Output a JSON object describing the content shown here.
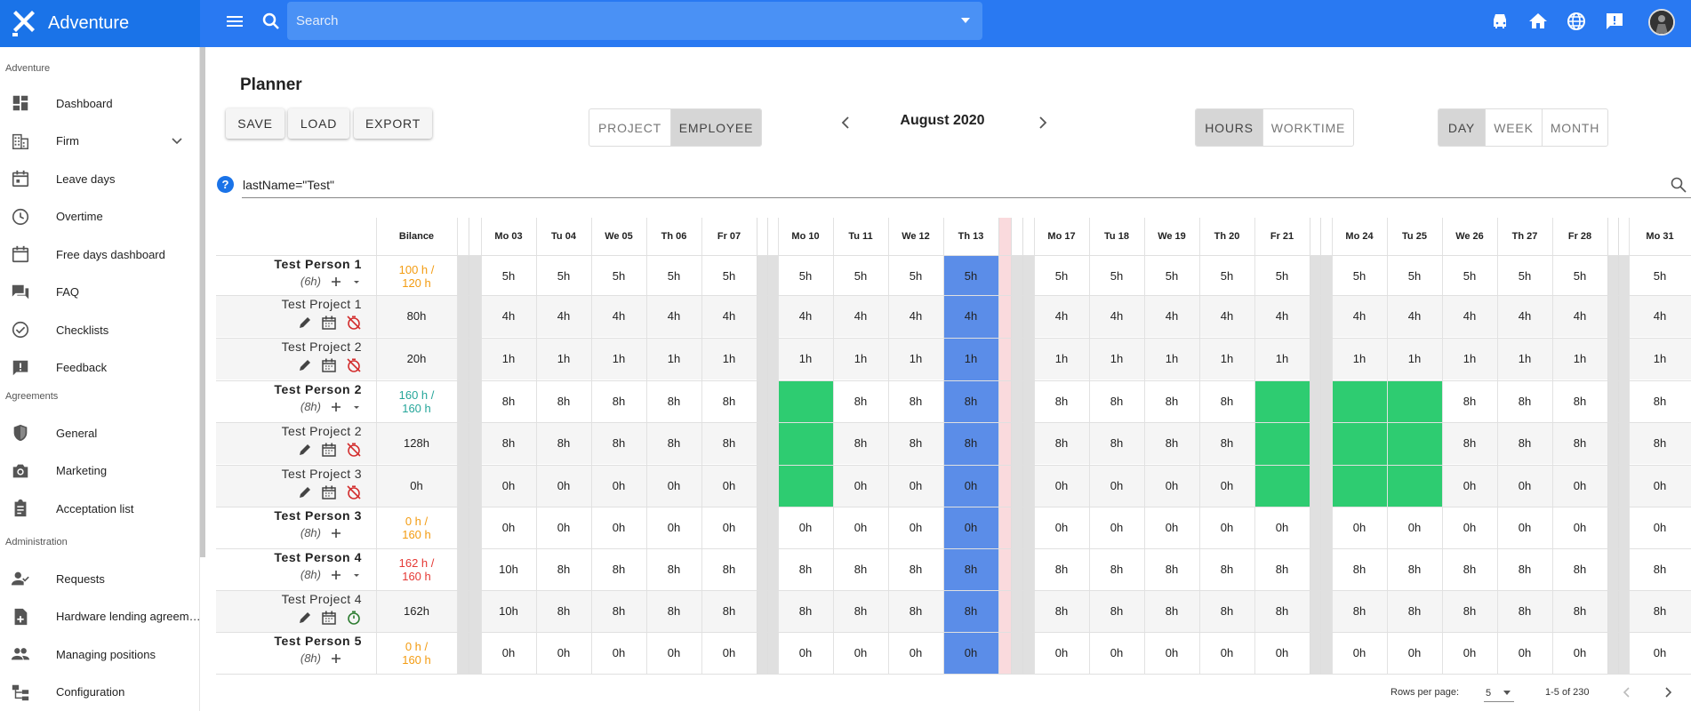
{
  "app": {
    "name": "Adventure"
  },
  "topbar": {
    "search_placeholder": "Search",
    "icons": [
      "menu-icon",
      "search-icon",
      "taxi-icon",
      "home-icon",
      "globe-icon",
      "feedback-icon",
      "avatar"
    ]
  },
  "sidebar": {
    "sections": [
      {
        "label": "Adventure",
        "items": [
          {
            "label": "Dashboard",
            "icon": "dashboard-icon"
          },
          {
            "label": "Firm",
            "icon": "firm-icon",
            "expandable": true
          },
          {
            "label": "Leave days",
            "icon": "calendar-icon"
          },
          {
            "label": "Overtime",
            "icon": "clock-icon"
          },
          {
            "label": "Free days dashboard",
            "icon": "calendar-blank-icon"
          },
          {
            "label": "FAQ",
            "icon": "forum-icon"
          },
          {
            "label": "Checklists",
            "icon": "check-circle-icon"
          },
          {
            "label": "Feedback",
            "icon": "feedback-icon"
          }
        ]
      },
      {
        "label": "Agreements",
        "items": [
          {
            "label": "General",
            "icon": "shield-icon"
          },
          {
            "label": "Marketing",
            "icon": "camera-icon"
          },
          {
            "label": "Acceptation list",
            "icon": "clipboard-icon"
          }
        ]
      },
      {
        "label": "Administration",
        "items": [
          {
            "label": "Requests",
            "icon": "person-check-icon"
          },
          {
            "label": "Hardware lending agreem…",
            "icon": "note-add-icon"
          },
          {
            "label": "Managing positions",
            "icon": "people-icon"
          },
          {
            "label": "Configuration",
            "icon": "tree-icon"
          }
        ]
      }
    ]
  },
  "planner": {
    "title": "Planner",
    "buttons": {
      "save": "SAVE",
      "load": "LOAD",
      "export": "EXPORT"
    },
    "mode_toggle": {
      "options": [
        "PROJECT",
        "EMPLOYEE"
      ],
      "active": "EMPLOYEE"
    },
    "month": "August 2020",
    "unit_toggle": {
      "options": [
        "HOURS",
        "WORKTIME"
      ],
      "active": "HOURS"
    },
    "range_toggle": {
      "options": [
        "DAY",
        "WEEK",
        "MONTH"
      ],
      "active": "DAY"
    },
    "filter": "lastName=\"Test\"",
    "bilance_header": "Bilance",
    "days": [
      "Mo 03",
      "Tu 04",
      "We 05",
      "Th 06",
      "Fr 07",
      "Mo 10",
      "Tu 11",
      "We 12",
      "Th 13",
      "Mo 17",
      "Tu 18",
      "We 19",
      "Th 20",
      "Fr 21",
      "Mo 24",
      "Tu 25",
      "We 26",
      "Th 27",
      "Fr 28",
      "Mo 31"
    ],
    "highlight_day": "Th 13",
    "rows": [
      {
        "type": "person",
        "name": "Test Person 1",
        "sub": "(6h)",
        "bilance": "100 h /",
        "bilance2": "120 h",
        "bilance_color": "#f39c12",
        "expandable": true,
        "cells": [
          "5h",
          "5h",
          "5h",
          "5h",
          "5h",
          "5h",
          "5h",
          "5h",
          "5h",
          "5h",
          "5h",
          "5h",
          "5h",
          "5h",
          "5h",
          "5h",
          "5h",
          "5h",
          "5h",
          "5h"
        ]
      },
      {
        "type": "project",
        "name": "Test Project 1",
        "bilance": "80h",
        "timer": "#d32f2f",
        "cells": [
          "4h",
          "4h",
          "4h",
          "4h",
          "4h",
          "4h",
          "4h",
          "4h",
          "4h",
          "4h",
          "4h",
          "4h",
          "4h",
          "4h",
          "4h",
          "4h",
          "4h",
          "4h",
          "4h",
          "4h"
        ]
      },
      {
        "type": "project",
        "name": "Test Project 2",
        "bilance": "20h",
        "timer": "#d32f2f",
        "cells": [
          "1h",
          "1h",
          "1h",
          "1h",
          "1h",
          "1h",
          "1h",
          "1h",
          "1h",
          "1h",
          "1h",
          "1h",
          "1h",
          "1h",
          "1h",
          "1h",
          "1h",
          "1h",
          "1h",
          "1h"
        ]
      },
      {
        "type": "person",
        "name": "Test Person 2",
        "sub": "(8h)",
        "bilance": "160 h /",
        "bilance2": "160 h",
        "bilance_color": "#26a69a",
        "expandable": true,
        "cells": [
          "8h",
          "8h",
          "8h",
          "8h",
          "8h",
          "",
          "8h",
          "8h",
          "8h",
          "8h",
          "8h",
          "8h",
          "8h",
          "",
          "",
          "",
          "8h",
          "8h",
          "8h",
          "8h"
        ]
      },
      {
        "type": "project",
        "name": "Test Project 2",
        "bilance": "128h",
        "timer": "#d32f2f",
        "cells": [
          "8h",
          "8h",
          "8h",
          "8h",
          "8h",
          "",
          "8h",
          "8h",
          "8h",
          "8h",
          "8h",
          "8h",
          "8h",
          "",
          "",
          "",
          "8h",
          "8h",
          "8h",
          "8h"
        ]
      },
      {
        "type": "project",
        "name": "Test Project 3",
        "bilance": "0h",
        "timer": "#d32f2f",
        "cells": [
          "0h",
          "0h",
          "0h",
          "0h",
          "0h",
          "",
          "0h",
          "0h",
          "0h",
          "0h",
          "0h",
          "0h",
          "0h",
          "",
          "",
          "",
          "0h",
          "0h",
          "0h",
          "0h"
        ]
      },
      {
        "type": "person",
        "name": "Test Person 3",
        "sub": "(8h)",
        "bilance": "0 h /",
        "bilance2": "160 h",
        "bilance_color": "#f39c12",
        "expandable": false,
        "cells": [
          "0h",
          "0h",
          "0h",
          "0h",
          "0h",
          "0h",
          "0h",
          "0h",
          "0h",
          "0h",
          "0h",
          "0h",
          "0h",
          "0h",
          "0h",
          "0h",
          "0h",
          "0h",
          "0h",
          "0h"
        ]
      },
      {
        "type": "person",
        "name": "Test Person 4",
        "sub": "(8h)",
        "bilance": "162 h /",
        "bilance2": "160 h",
        "bilance_color": "#e53935",
        "expandable": true,
        "cells": [
          "10h",
          "8h",
          "8h",
          "8h",
          "8h",
          "8h",
          "8h",
          "8h",
          "8h",
          "8h",
          "8h",
          "8h",
          "8h",
          "8h",
          "8h",
          "8h",
          "8h",
          "8h",
          "8h",
          "8h"
        ]
      },
      {
        "type": "project",
        "name": "Test Project 4",
        "bilance": "162h",
        "timer": "#2e7d32",
        "cells": [
          "10h",
          "8h",
          "8h",
          "8h",
          "8h",
          "8h",
          "8h",
          "8h",
          "8h",
          "8h",
          "8h",
          "8h",
          "8h",
          "8h",
          "8h",
          "8h",
          "8h",
          "8h",
          "8h",
          "8h"
        ]
      },
      {
        "type": "person",
        "name": "Test Person 5",
        "sub": "(8h)",
        "bilance": "0 h /",
        "bilance2": "160 h",
        "bilance_color": "#f39c12",
        "expandable": false,
        "cells": [
          "0h",
          "0h",
          "0h",
          "0h",
          "0h",
          "0h",
          "0h",
          "0h",
          "0h",
          "0h",
          "0h",
          "0h",
          "0h",
          "0h",
          "0h",
          "0h",
          "0h",
          "0h",
          "0h",
          "0h"
        ]
      }
    ],
    "green_blocks": [
      {
        "day": "Mo 10",
        "rows": [
          3,
          5
        ]
      },
      {
        "day": "Fr 21",
        "rows": [
          3,
          5
        ]
      },
      {
        "day": "Mo 24",
        "rows": [
          3,
          5
        ]
      },
      {
        "day": "Tu 25",
        "rows": [
          3,
          5
        ]
      }
    ],
    "colors": {
      "highlight": "#5b8de8",
      "green": "#2ecc71",
      "weekend": "#e0e0e0",
      "holiday": "#fadadd",
      "alt_row": "#f5f5f5"
    }
  },
  "footer": {
    "rows_per_page_label": "Rows per page:",
    "rows_per_page": "5",
    "range": "1-5 of 230"
  }
}
